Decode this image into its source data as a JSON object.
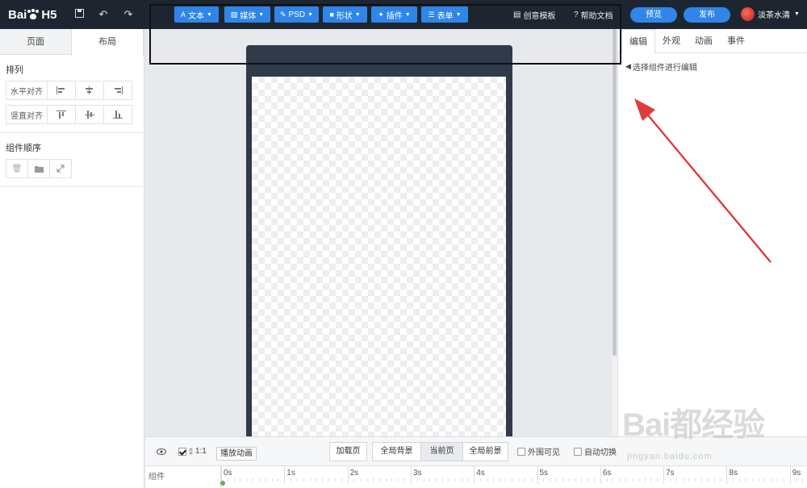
{
  "header": {
    "logo_text_left": "Bai",
    "logo_text_right": "H5",
    "tools": [
      {
        "label": "文本",
        "icon": "A"
      },
      {
        "label": "媒体",
        "icon": "▨"
      },
      {
        "label": "PSD",
        "icon": "✎"
      },
      {
        "label": "形状",
        "icon": "■"
      },
      {
        "label": "插件",
        "icon": "✦"
      },
      {
        "label": "表单",
        "icon": "☰"
      }
    ],
    "template_link": "创意模板",
    "help_link": "帮助文档",
    "preview_btn": "预览",
    "publish_btn": "发布",
    "username": "淡茶水清"
  },
  "left_panel": {
    "tabs": [
      "页面",
      "布局"
    ],
    "active_tab": "布局",
    "arrange_title": "排列",
    "h_align_label": "水平对齐",
    "v_align_label": "竖直对齐",
    "order_title": "组件顺序"
  },
  "right_panel": {
    "tabs": [
      "编辑",
      "外观",
      "动画",
      "事件"
    ],
    "active_tab": "编辑",
    "hint": "选择组件进行编辑"
  },
  "bottom_bar": {
    "ratio_label": "1:1",
    "play_btn": "播放动画",
    "page_buttons": [
      "加载页",
      "全局背景",
      "当前页",
      "全局前景"
    ],
    "active_page": "当前页",
    "outer_visible": "外围可见",
    "auto_switch": "自动切换",
    "timeline_label": "组件",
    "ticks": [
      "0s",
      "1s",
      "2s",
      "3s",
      "4s",
      "5s",
      "6s",
      "7s",
      "8s",
      "9s"
    ]
  },
  "watermark": {
    "main": "Bai都经验",
    "sub": "jingyan.baidu.com"
  },
  "colors": {
    "topbar": "#1d2630",
    "accent": "#2f86e8",
    "arrow": "#e03c3c",
    "phone_frame": "#2f3a4a"
  }
}
